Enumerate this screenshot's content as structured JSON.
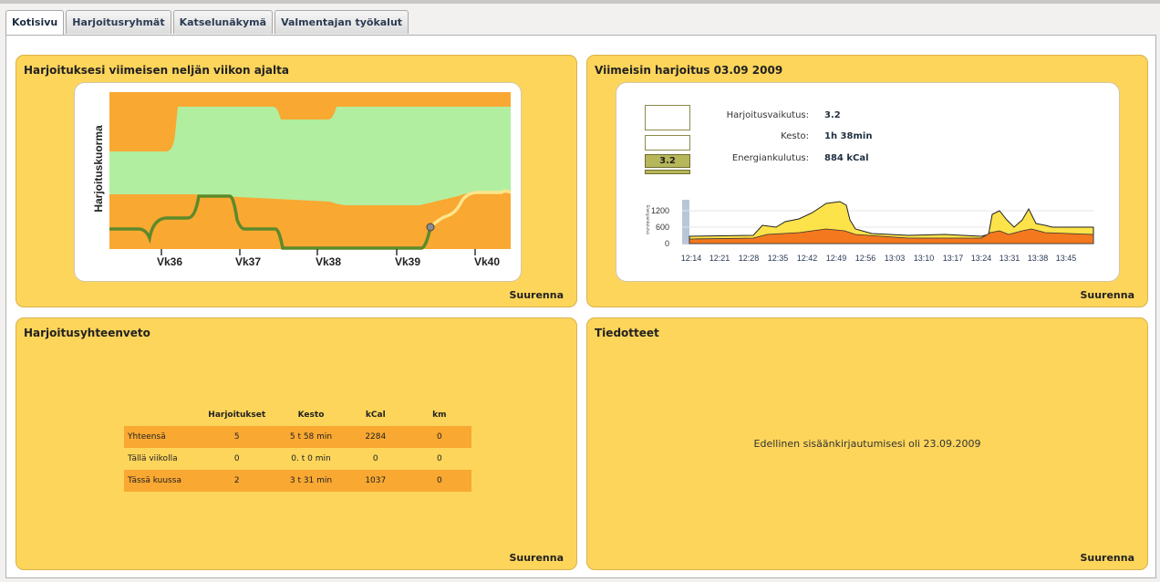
{
  "tabs": [
    "Kotisivu",
    "Harjoitusryhmät",
    "Katselunäkymä",
    "Valmentajan työkalut"
  ],
  "more_label": "Suurenna",
  "panels": {
    "weeks": {
      "title": "Harjoituksesi viimeisen neljän viikon ajalta",
      "ylabel": "Harjoituskuorma",
      "week_labels": [
        "Vk36",
        "Vk37",
        "Vk38",
        "Vk39",
        "Vk40"
      ]
    },
    "latest": {
      "title": "Viimeisin harjoitus 03.09 2009",
      "gauge_value": "3.2",
      "stats": [
        {
          "label": "Harjoitusvaikutus:",
          "value": "3.2"
        },
        {
          "label": "Kesto:",
          "value": "1h 38min"
        },
        {
          "label": "Energiankulutus:",
          "value": "884 kCal"
        }
      ],
      "hr_axis_label": "Energiankulutus",
      "y_ticks": [
        "1200",
        "600",
        "0"
      ],
      "time_ticks": [
        "12:14",
        "12:21",
        "12:28",
        "12:35",
        "12:42",
        "12:49",
        "12:56",
        "13:03",
        "13:10",
        "13:17",
        "13:24",
        "13:31",
        "13:38",
        "13:45"
      ]
    },
    "summary": {
      "title": "Harjoitusyhteenveto",
      "columns": [
        "",
        "Harjoitukset",
        "Kesto",
        "kCal",
        "km"
      ],
      "rows": [
        [
          "Yhteensä",
          "5",
          "5 t 58 min",
          "2284",
          "0"
        ],
        [
          "Tällä viikolla",
          "0",
          "0. t 0 min",
          "0",
          "0"
        ],
        [
          "Tässä kuussa",
          "2",
          "3 t 31 min",
          "1037",
          "0"
        ]
      ]
    },
    "notices": {
      "title": "Tiedotteet",
      "text": "Edellinen sisäänkirjautumisesi oli 23.09.2009"
    }
  },
  "colors": {
    "panel": "#fdd55b",
    "orange": "#f9a832",
    "green_band": "#b2eea0",
    "load_line": "#5c8a2a",
    "future_line": "#fce58a"
  }
}
